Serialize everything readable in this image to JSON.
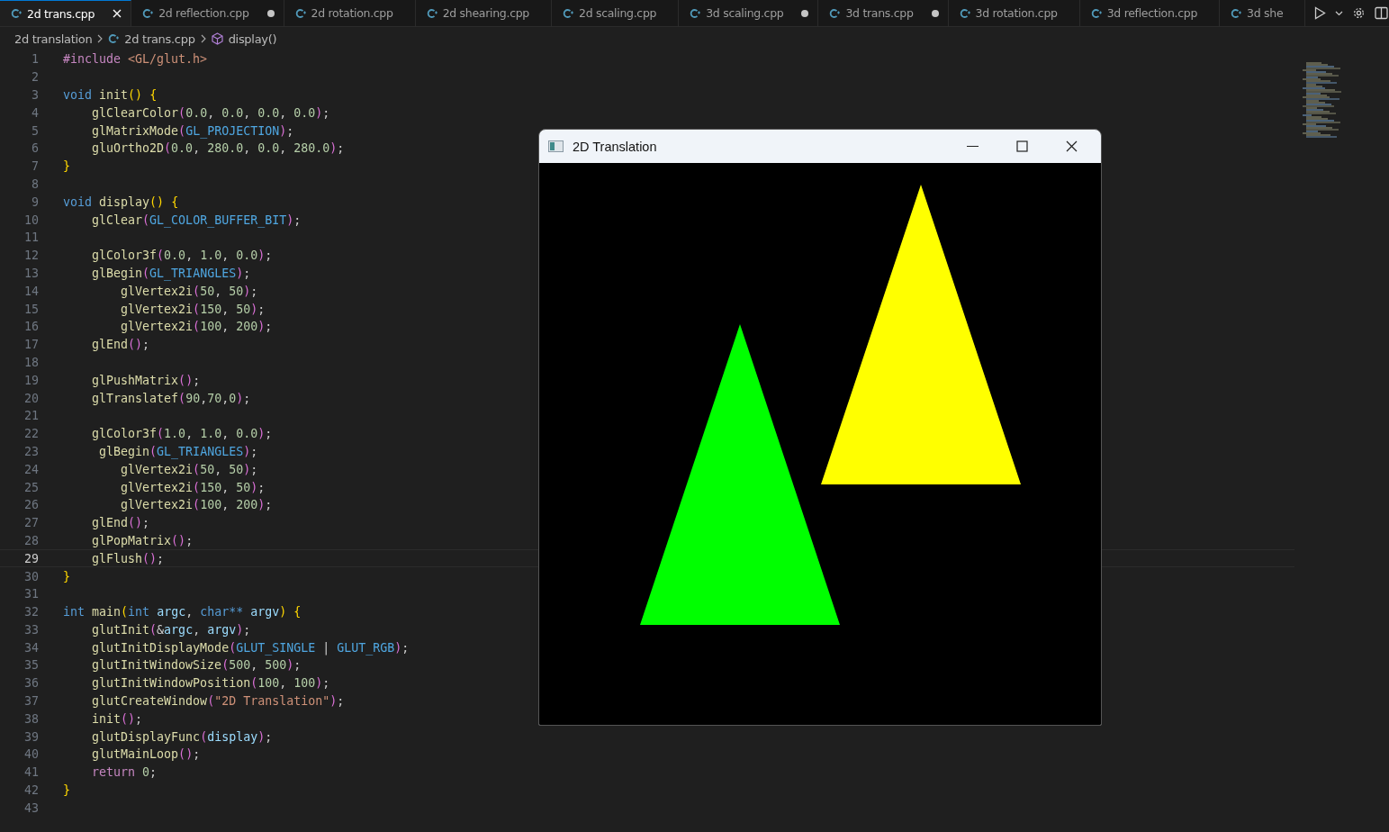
{
  "tabs": [
    {
      "label": "2d trans.cpp",
      "selected": true,
      "modified": false
    },
    {
      "label": "2d reflection.cpp",
      "selected": false,
      "modified": true
    },
    {
      "label": "2d rotation.cpp",
      "selected": false,
      "modified": false
    },
    {
      "label": "2d shearing.cpp",
      "selected": false,
      "modified": false
    },
    {
      "label": "2d scaling.cpp",
      "selected": false,
      "modified": false
    },
    {
      "label": "3d scaling.cpp",
      "selected": false,
      "modified": true
    },
    {
      "label": "3d trans.cpp",
      "selected": false,
      "modified": true
    },
    {
      "label": "3d rotation.cpp",
      "selected": false,
      "modified": false
    },
    {
      "label": "3d reflection.cpp",
      "selected": false,
      "modified": false
    },
    {
      "label": "3d she",
      "selected": false,
      "modified": false
    }
  ],
  "breadcrumb": [
    {
      "label": "2d translation",
      "kind": "folder"
    },
    {
      "label": "2d trans.cpp",
      "kind": "file"
    },
    {
      "label": "display()",
      "kind": "symbol"
    }
  ],
  "lines": [
    {
      "number": "1",
      "current": false,
      "text": "#include <GL/glut.h>"
    },
    {
      "number": "2",
      "current": false
    },
    {
      "number": "3",
      "current": false,
      "text": "void init() {"
    },
    {
      "number": "4",
      "current": false,
      "text": "    glClearColor(0.0, 0.0, 0.0, 0.0);"
    },
    {
      "number": "5",
      "current": false,
      "text": "    glMatrixMode(GL_PROJECTION);"
    },
    {
      "number": "6",
      "current": false,
      "text": "    gluOrtho2D(0.0, 280.0, 0.0, 280.0);"
    },
    {
      "number": "7",
      "current": false,
      "text": "}"
    },
    {
      "number": "8",
      "current": false
    },
    {
      "number": "9",
      "current": false,
      "text": "void display() {"
    },
    {
      "number": "10",
      "current": false,
      "text": "    glClear(GL_COLOR_BUFFER_BIT);"
    },
    {
      "number": "11",
      "current": false
    },
    {
      "number": "12",
      "current": false,
      "text": "    glColor3f(0.0, 1.0, 0.0);"
    },
    {
      "number": "13",
      "current": false,
      "text": "    glBegin(GL_TRIANGLES);"
    },
    {
      "number": "14",
      "current": false,
      "text": "        glVertex2i(50, 50);"
    },
    {
      "number": "15",
      "current": false,
      "text": "        glVertex2i(150, 50);"
    },
    {
      "number": "16",
      "current": false,
      "text": "        glVertex2i(100, 200);"
    },
    {
      "number": "17",
      "current": false,
      "text": "    glEnd();"
    },
    {
      "number": "18",
      "current": false
    },
    {
      "number": "19",
      "current": false,
      "text": "    glPushMatrix();"
    },
    {
      "number": "20",
      "current": false,
      "text": "    glTranslatef(90,70,0);"
    },
    {
      "number": "21",
      "current": false
    },
    {
      "number": "22",
      "current": false,
      "text": "    glColor3f(1.0, 1.0, 0.0);"
    },
    {
      "number": "23",
      "current": false,
      "text": "     glBegin(GL_TRIANGLES);"
    },
    {
      "number": "24",
      "current": false,
      "text": "        glVertex2i(50, 50);"
    },
    {
      "number": "25",
      "current": false,
      "text": "        glVertex2i(150, 50);"
    },
    {
      "number": "26",
      "current": false,
      "text": "        glVertex2i(100, 200);"
    },
    {
      "number": "27",
      "current": false,
      "text": "    glEnd();"
    },
    {
      "number": "28",
      "current": false,
      "text": "    glPopMatrix();"
    },
    {
      "number": "29",
      "current": true,
      "text": "    glFlush();"
    },
    {
      "number": "30",
      "current": false,
      "text": "}"
    },
    {
      "number": "31",
      "current": false
    },
    {
      "number": "32",
      "current": false,
      "text": "int main(int argc, char** argv) {"
    },
    {
      "number": "33",
      "current": false,
      "text": "    glutInit(&argc, argv);"
    },
    {
      "number": "34",
      "current": false,
      "text": "    glutInitDisplayMode(GLUT_SINGLE | GLUT_RGB);"
    },
    {
      "number": "35",
      "current": false,
      "text": "    glutInitWindowSize(500, 500);"
    },
    {
      "number": "36",
      "current": false,
      "text": "    glutInitWindowPosition(100, 100);"
    },
    {
      "number": "37",
      "current": false,
      "text": "    glutCreateWindow(\"2D Translation\");"
    },
    {
      "number": "38",
      "current": false,
      "text": "    init();"
    },
    {
      "number": "39",
      "current": false,
      "text": "    glutDisplayFunc(display);"
    },
    {
      "number": "40",
      "current": false,
      "text": "    glutMainLoop();"
    },
    {
      "number": "41",
      "current": false,
      "text": "    return 0;"
    },
    {
      "number": "42",
      "current": false,
      "text": "}"
    },
    {
      "number": "43",
      "current": false
    }
  ],
  "glut_window": {
    "title": "2D Translation"
  }
}
